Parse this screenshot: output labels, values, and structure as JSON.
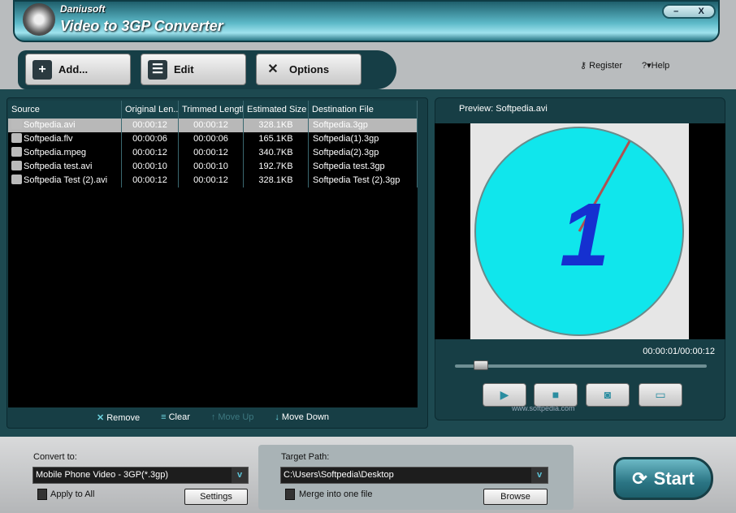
{
  "app": {
    "brand": "Daniusoft",
    "title": "Video to 3GP Converter",
    "minimize": "–",
    "close": "X"
  },
  "toolbar": {
    "add": "Add...",
    "edit": "Edit",
    "options": "Options",
    "register": "Register",
    "help": "Help"
  },
  "list": {
    "headers": [
      "Source",
      "Original Len...",
      "Trimmed Length",
      "Estimated Size",
      "Destination File"
    ],
    "rows": [
      [
        "Softpedia.avi",
        "00:00:12",
        "00:00:12",
        "328.1KB",
        "Softpedia.3gp"
      ],
      [
        "Softpedia.flv",
        "00:00:06",
        "00:00:06",
        "165.1KB",
        "Softpedia(1).3gp"
      ],
      [
        "Softpedia.mpeg",
        "00:00:12",
        "00:00:12",
        "340.7KB",
        "Softpedia(2).3gp"
      ],
      [
        "Softpedia test.avi",
        "00:00:10",
        "00:00:10",
        "192.7KB",
        "Softpedia test.3gp"
      ],
      [
        "Softpedia Test (2).avi",
        "00:00:12",
        "00:00:12",
        "328.1KB",
        "Softpedia Test (2).3gp"
      ]
    ],
    "actions": {
      "remove": "Remove",
      "clear": "Clear",
      "move_up": "Move Up",
      "move_down": "Move Down"
    }
  },
  "preview": {
    "label": "Preview: Softpedia.avi",
    "time": "00:00:01/00:00:12",
    "progress": 0.08,
    "watermark": "www.softpedia.com"
  },
  "bottom": {
    "convert_label": "Convert to:",
    "format": "Mobile Phone Video - 3GP(*.3gp)",
    "apply_all": "Apply to All",
    "settings": "Settings",
    "target_label": "Target Path:",
    "path": "C:\\Users\\Softpedia\\Desktop",
    "merge": "Merge into one file",
    "browse": "Browse",
    "start": "Start"
  }
}
